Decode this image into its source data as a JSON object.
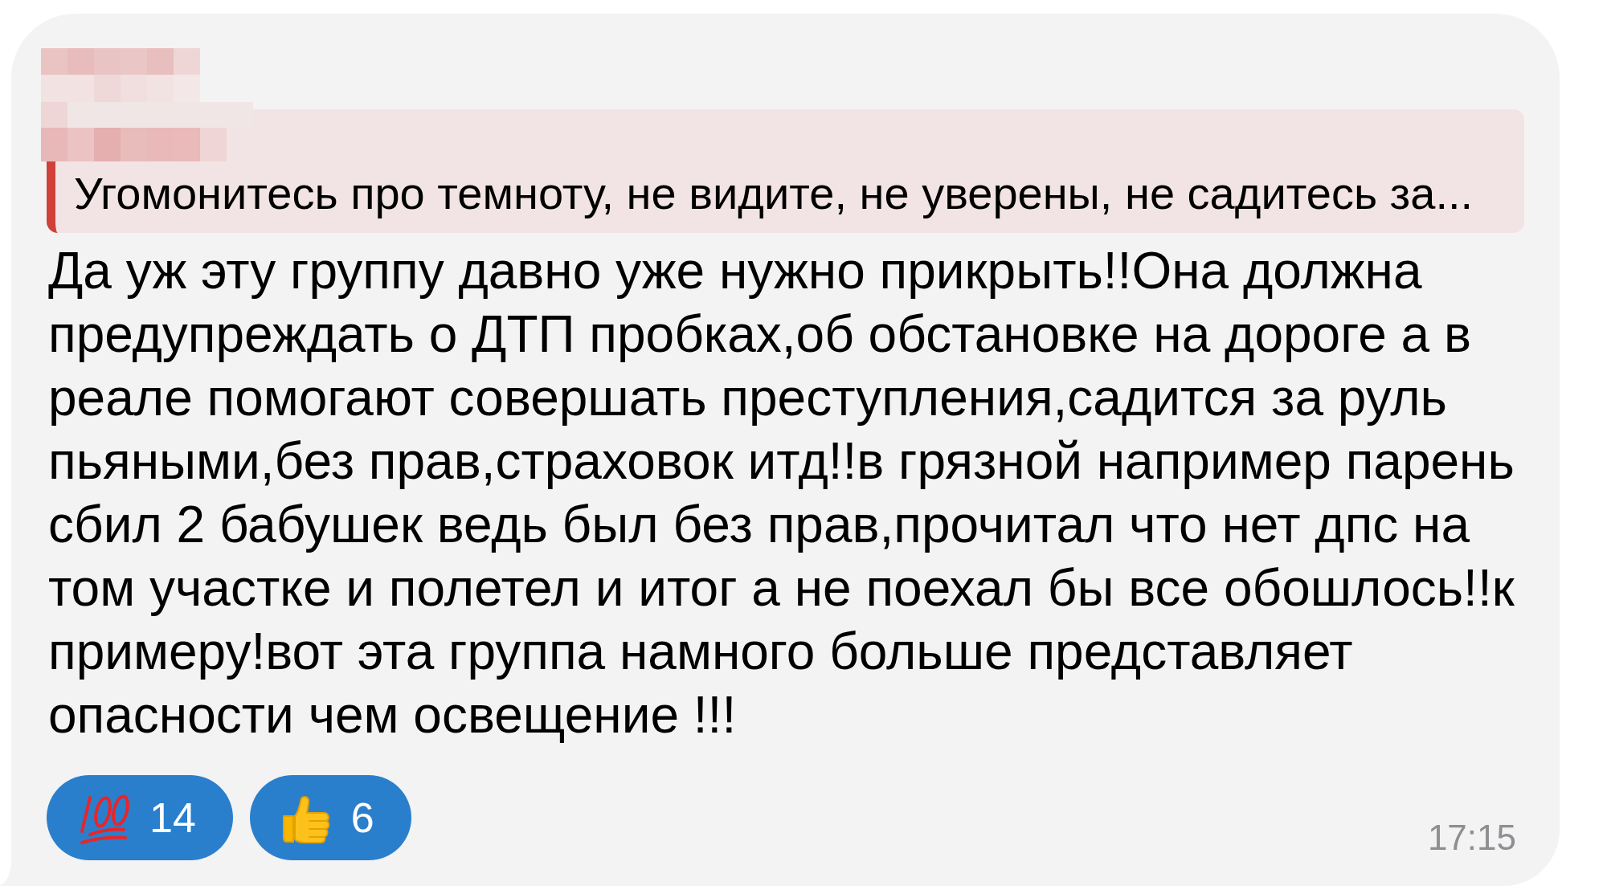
{
  "message": {
    "reply": {
      "text": "Угомонитесь про темноту, не видите, не уверены, не садитесь за..."
    },
    "text": "Да уж эту группу давно уже нужно прикрыть!!Она должна предупреждать о ДТП пробках,об обстановке на дороге а в реале помогают совершать преступления,садится за руль пьяными,без прав,страховок итд!!в грязной например парень сбил 2 бабушек ведь был без прав,прочитал что нет дпс на том участке и полетел и итог а не поехал бы все обошлось!!к примеру!вот эта группа намного больше представляет опасности чем освещение !!!",
    "reactions": [
      {
        "kind": "hundred",
        "count": "14"
      },
      {
        "kind": "thumbs_up",
        "count": "6"
      }
    ],
    "time": "17:15"
  }
}
